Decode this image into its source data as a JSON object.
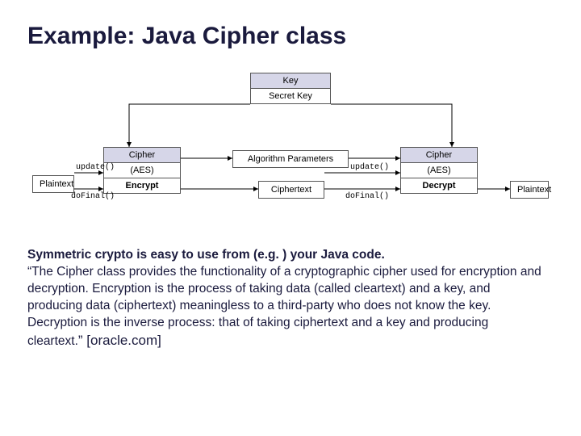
{
  "title": "Example: Java Cipher class",
  "diagram": {
    "key": {
      "header": "Key",
      "secret": "Secret Key"
    },
    "cipher1": {
      "header": "Cipher",
      "alg": "(AES)",
      "op": "Encrypt"
    },
    "cipher2": {
      "header": "Cipher",
      "alg": "(AES)",
      "op": "Decrypt"
    },
    "algparams": "Algorithm Parameters",
    "plaintext1": "Plaintext",
    "ciphertext": "Ciphertext",
    "plaintext2": "Plaintext",
    "labels": {
      "update1": "update()",
      "dofinal1": "doFinal()",
      "update2": "update()",
      "dofinal2": "doFinal()"
    }
  },
  "body": {
    "lead": "Symmetric crypto is easy to use from (e.g. ) your Java code.",
    "quote": "“The Cipher class provides the functionality of a cryptographic cipher used for encryption and decryption. Encryption is the process of taking data (called cleartext) and a key, and producing data (ciphertext) meaningless to a third-party who does not know the key. Decryption is the inverse process: that of taking ciphertext and a key and producing cleartext.",
    "close": "”",
    "cite": " [oracle.com]"
  }
}
